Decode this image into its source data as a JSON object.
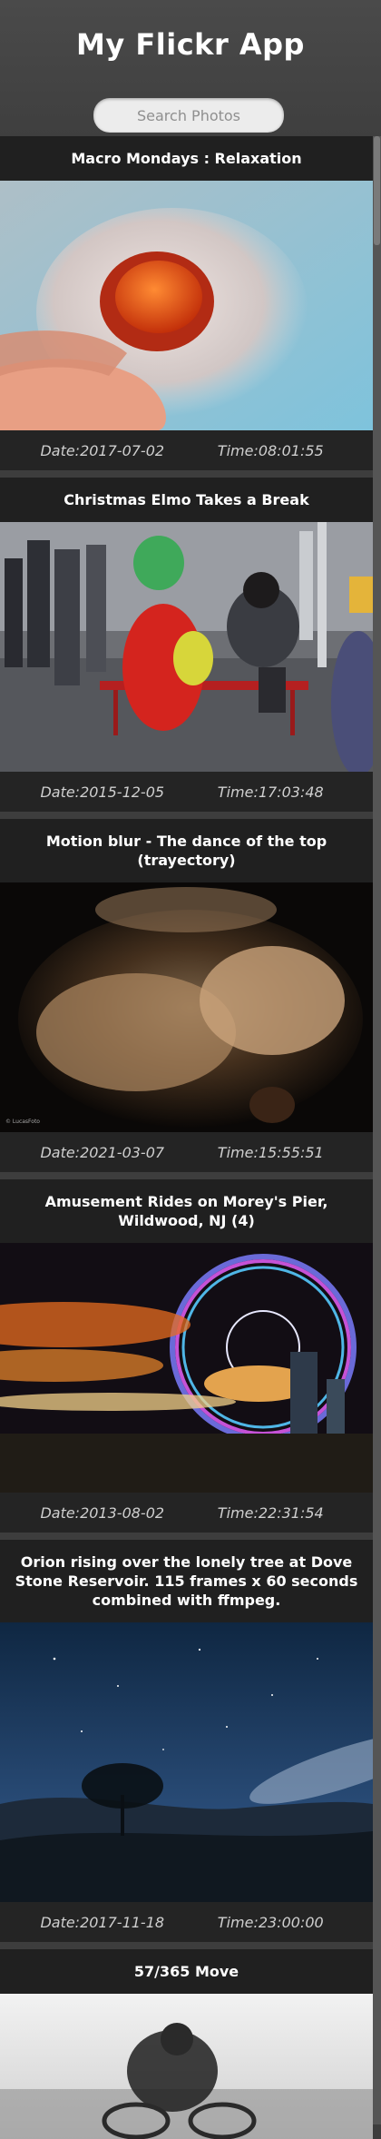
{
  "app": {
    "title": "My Flickr App"
  },
  "search": {
    "placeholder": "Search Photos"
  },
  "photos": [
    {
      "title": "Macro Mondays : Relaxation",
      "date": "Date:2017-07-02",
      "time": "Time:08:01:55"
    },
    {
      "title": "Christmas Elmo Takes a Break",
      "date": "Date:2015-12-05",
      "time": "Time:17:03:48"
    },
    {
      "title": "Motion blur - The dance of the top (trayectory)",
      "date": "Date:2021-03-07",
      "time": "Time:15:55:51",
      "watermark": "© LucasFoto"
    },
    {
      "title": "Amusement Rides on Morey's Pier, Wildwood, NJ (4)",
      "date": "Date:2013-08-02",
      "time": "Time:22:31:54"
    },
    {
      "title": "Orion rising over the lonely tree at Dove Stone Reservoir. 115 frames x 60 seconds combined with ffmpeg.",
      "date": "Date:2017-11-18",
      "time": "Time:23:00:00"
    },
    {
      "title": "57/365 Move"
    }
  ]
}
